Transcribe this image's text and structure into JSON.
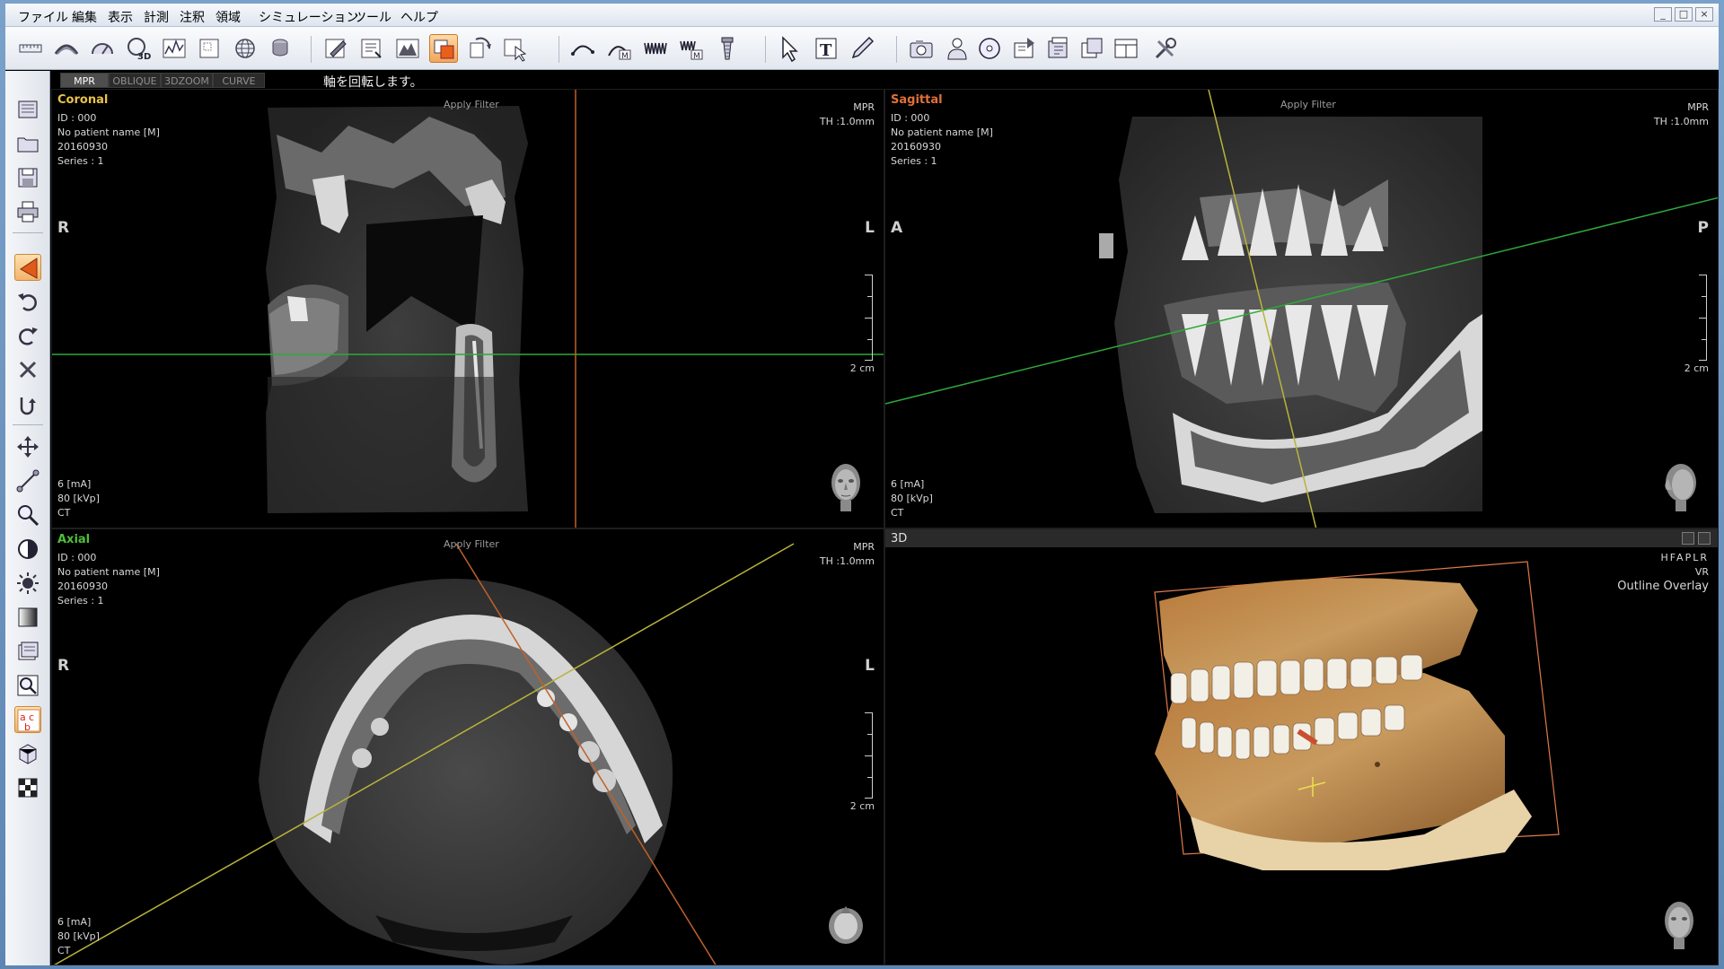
{
  "menu": [
    "ファイル",
    "編集",
    "表示",
    "計測",
    "注釈",
    "領域",
    "シミュレーション",
    "ツール",
    "ヘルプ"
  ],
  "window_controls": [
    "_",
    "□",
    "×"
  ],
  "mode_tabs": [
    "MPR",
    "OBLIQUE",
    "3DZOOM",
    "CURVE"
  ],
  "active_tab": "MPR",
  "hint": "軸を回転します。",
  "viewports": {
    "coronal": {
      "title": "Coronal",
      "title_color": "#e8c24a",
      "id": "ID : 000",
      "patient": "No patient name [M]",
      "date": "20160930",
      "series": "Series : 1",
      "filter": "Apply Filter",
      "mode": "MPR",
      "thickness": "TH :1.0mm",
      "orient_left": "R",
      "orient_right": "L",
      "scale": "2 cm",
      "ma": "6 [mA]",
      "kvp": "80 [kVp]",
      "modality": "CT"
    },
    "sagittal": {
      "title": "Sagittal",
      "title_color": "#e0703a",
      "id": "ID : 000",
      "patient": "No patient name [M]",
      "date": "20160930",
      "series": "Series : 1",
      "filter": "Apply Filter",
      "mode": "MPR",
      "thickness": "TH :1.0mm",
      "orient_left": "A",
      "orient_right": "P",
      "scale": "2 cm",
      "ma": "6 [mA]",
      "kvp": "80 [kVp]",
      "modality": "CT"
    },
    "axial": {
      "title": "Axial",
      "title_color": "#4fbf3a",
      "id": "ID : 000",
      "patient": "No patient name [M]",
      "date": "20160930",
      "series": "Series : 1",
      "filter": "Apply Filter",
      "mode": "MPR",
      "thickness": "TH :1.0mm",
      "orient_left": "R",
      "orient_right": "L",
      "scale": "2 cm",
      "ma": "6 [mA]",
      "kvp": "80 [kVp]",
      "modality": "CT"
    },
    "render3d": {
      "title": "3D",
      "preset": "HFAPLR",
      "render_mode": "VR",
      "overlay": "Outline Overlay"
    }
  },
  "colors": {
    "crosshair_green": "#2fa83a",
    "crosshair_orange": "#c0612a",
    "crosshair_yellow": "#b9b33a",
    "bone_3d": "#b8864a"
  }
}
